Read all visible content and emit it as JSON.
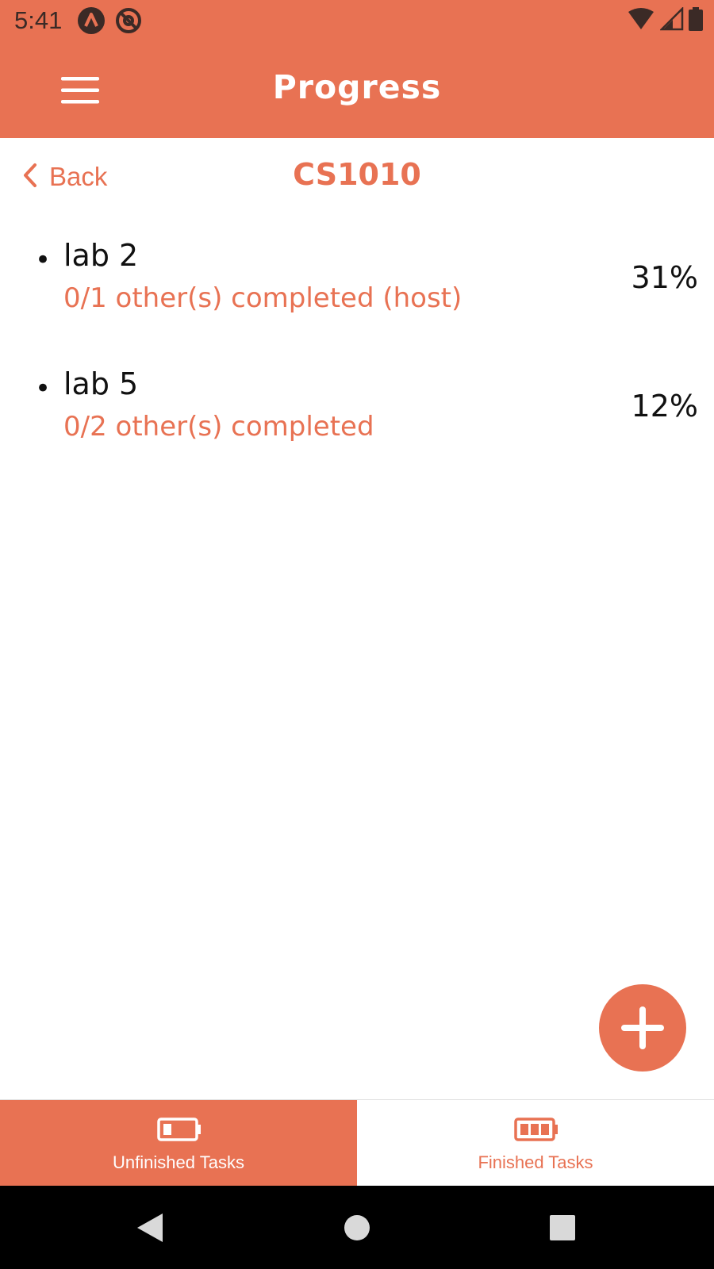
{
  "status_bar": {
    "time": "5:41",
    "left_icons": [
      "app-notification-icon",
      "at-sign-icon"
    ],
    "right_icons": [
      "wifi-icon",
      "cell-signal-icon",
      "battery-icon"
    ]
  },
  "app_bar": {
    "title": "Progress",
    "menu_icon": "hamburger-menu-icon"
  },
  "header": {
    "back_label": "Back",
    "course_title": "CS1010"
  },
  "tasks": [
    {
      "bullet": "•",
      "name": "lab 2",
      "subtitle": "0/1 other(s) completed (host)",
      "percent": "31%"
    },
    {
      "bullet": "•",
      "name": "lab 5",
      "subtitle": "0/2 other(s) completed",
      "percent": "12%"
    }
  ],
  "fab": {
    "icon": "plus-icon"
  },
  "bottom_tabs": [
    {
      "label": "Unfinished Tasks",
      "icon": "battery-low-icon",
      "selected": true
    },
    {
      "label": "Finished Tasks",
      "icon": "battery-full-icon",
      "selected": false
    }
  ],
  "colors": {
    "accent": "#e87253",
    "text": "#111111",
    "background": "#ffffff",
    "nav_bar": "#000000"
  }
}
